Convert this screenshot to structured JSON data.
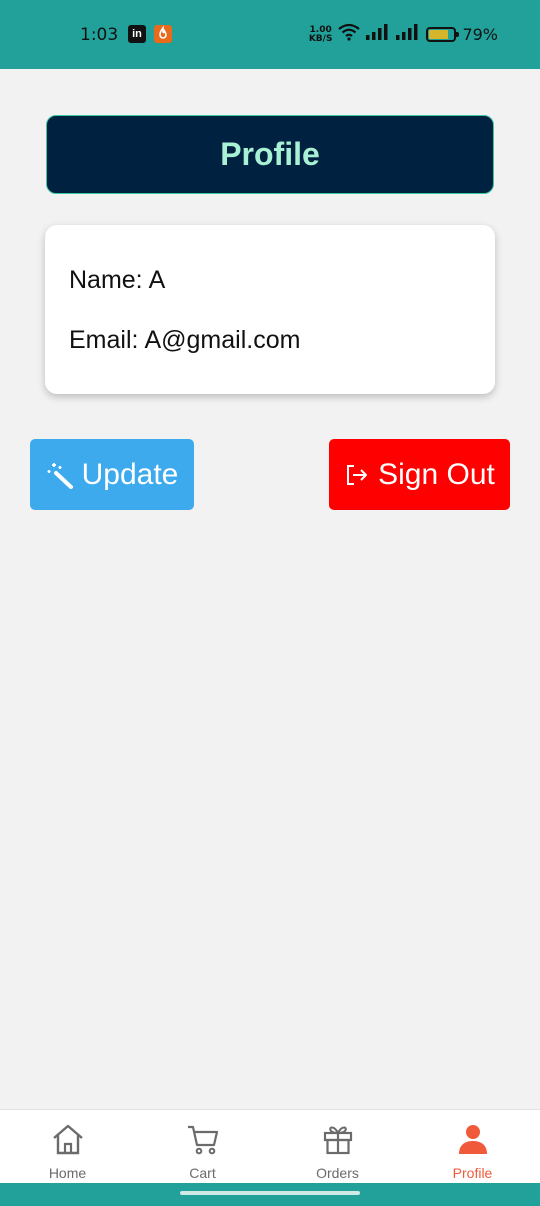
{
  "status_bar": {
    "time": "1:03",
    "app_icons": [
      "linkedin-icon",
      "app-flame-icon"
    ],
    "linkedin_label": "in",
    "net_speed_value": "1.00",
    "net_speed_unit": "KB/S",
    "battery_percent": "79%",
    "battery_level": 0.79,
    "background_color": "#21a19a"
  },
  "header": {
    "title": "Profile",
    "background_color": "#012140",
    "text_color": "#a9f1d4"
  },
  "profile": {
    "name_label": "Name:",
    "name_value": "A",
    "email_label": "Email:",
    "email_value": "A@gmail.com"
  },
  "actions": {
    "update_label": "Update",
    "update_icon": "magic-wand-icon",
    "update_color": "#3eaaee",
    "signout_label": "Sign Out",
    "signout_icon": "sign-out-icon",
    "signout_color": "#fe0000"
  },
  "bottom_nav": {
    "items": [
      {
        "label": "Home",
        "icon": "home-icon",
        "active": false
      },
      {
        "label": "Cart",
        "icon": "cart-icon",
        "active": false
      },
      {
        "label": "Orders",
        "icon": "gift-icon",
        "active": false
      },
      {
        "label": "Profile",
        "icon": "person-icon",
        "active": true
      }
    ],
    "active_color": "#f05a3a"
  }
}
